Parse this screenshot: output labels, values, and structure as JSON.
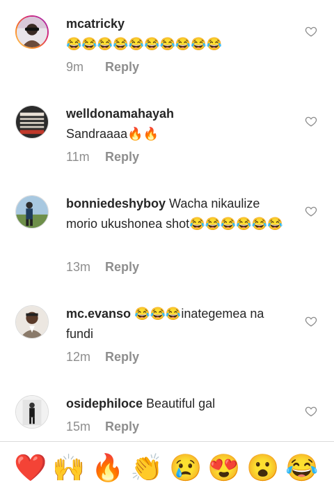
{
  "comments": [
    {
      "username": "mcatricky",
      "text": "😂😂😂😂😂😂😂😂😂😂",
      "time": "9m",
      "reply": "Reply"
    },
    {
      "username": "welldonamahayah",
      "text": "Sandraaaa🔥🔥",
      "time": "11m",
      "reply": "Reply"
    },
    {
      "username": "bonniedeshyboy",
      "text": "Wacha nikaulize morio ukushonea shot😂😂😂😂😂😂",
      "time": "13m",
      "reply": "Reply"
    },
    {
      "username": "mc.evanso",
      "text": "😂😂😂inategemea na fundi",
      "time": "12m",
      "reply": "Reply"
    },
    {
      "username": "osidephiloce",
      "text": "Beautiful gal",
      "time": "15m",
      "reply": "Reply"
    }
  ],
  "quick_reactions": [
    "❤️",
    "🙌",
    "🔥",
    "👏",
    "😢",
    "😍",
    "😮",
    "😂"
  ],
  "icons": {
    "like": "heart-outline-icon"
  },
  "colors": {
    "secondary_text": "#8e8e8e",
    "primary_text": "#262626",
    "divider": "#dbdbdb"
  }
}
